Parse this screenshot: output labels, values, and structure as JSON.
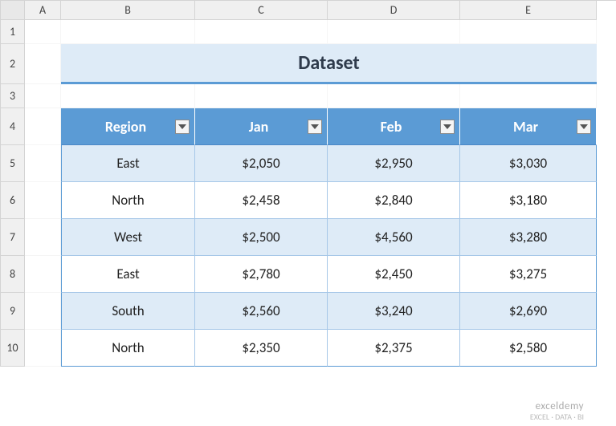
{
  "columns": [
    "A",
    "B",
    "C",
    "D",
    "E"
  ],
  "rows": [
    "1",
    "2",
    "3",
    "4",
    "5",
    "6",
    "7",
    "8",
    "9",
    "10"
  ],
  "title": "Dataset",
  "table": {
    "headers": [
      "Region",
      "Jan",
      "Feb",
      "Mar"
    ],
    "data": [
      [
        "East",
        "$2,050",
        "$2,950",
        "$3,030"
      ],
      [
        "North",
        "$2,458",
        "$2,840",
        "$3,180"
      ],
      [
        "West",
        "$2,500",
        "$4,560",
        "$3,280"
      ],
      [
        "East",
        "$2,780",
        "$2,450",
        "$3,275"
      ],
      [
        "South",
        "$2,560",
        "$3,240",
        "$2,690"
      ],
      [
        "North",
        "$2,350",
        "$2,375",
        "$2,580"
      ]
    ]
  },
  "watermark": {
    "brand": "exceldemy",
    "tagline": "EXCEL · DATA · BI"
  }
}
